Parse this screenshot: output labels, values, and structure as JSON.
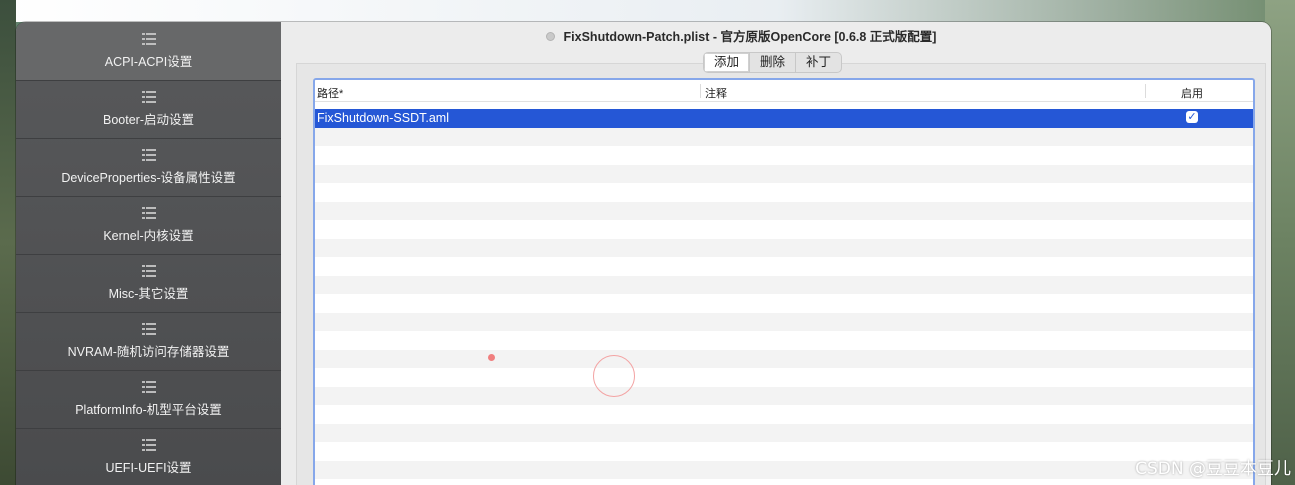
{
  "window": {
    "title": "FixShutdown-Patch.plist - 官方原版OpenCore [0.6.8 正式版配置]"
  },
  "sidebar": {
    "items": [
      {
        "label": "ACPI-ACPI设置",
        "active": true
      },
      {
        "label": "Booter-启动设置",
        "active": false
      },
      {
        "label": "DeviceProperties-设备属性设置",
        "active": false
      },
      {
        "label": "Kernel-内核设置",
        "active": false
      },
      {
        "label": "Misc-其它设置",
        "active": false
      },
      {
        "label": "NVRAM-随机访问存储器设置",
        "active": false
      },
      {
        "label": "PlatformInfo-机型平台设置",
        "active": false
      },
      {
        "label": "UEFI-UEFI设置",
        "active": false
      }
    ]
  },
  "segments": {
    "items": [
      "添加",
      "删除",
      "补丁"
    ],
    "selected": "添加"
  },
  "table": {
    "columns": [
      "路径*",
      "注释",
      "启用"
    ],
    "rows": [
      {
        "path": "FixShutdown-SSDT.aml",
        "comment": "",
        "enabled": true
      }
    ]
  },
  "colors": {
    "selection": "#2557d6",
    "focus_ring": "#86a7ea",
    "sidebar_bg": "#58595b"
  },
  "watermark": "CSDN @豆豆本豆儿"
}
